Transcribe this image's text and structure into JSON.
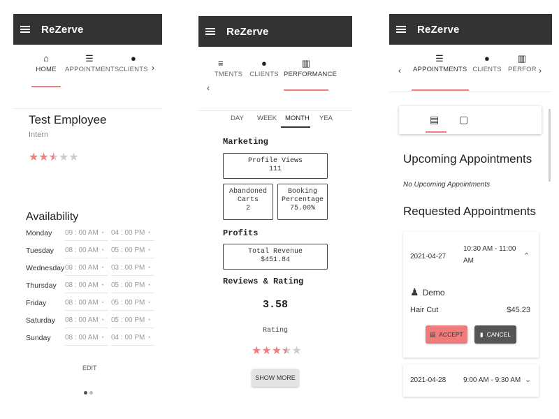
{
  "screens": [
    {
      "app_title": "ReZerve",
      "tabs": [
        {
          "icon": "home-icon",
          "label": "HOME",
          "active": true
        },
        {
          "icon": "list-icon",
          "label": "APPOINTMENTS",
          "active": false
        },
        {
          "icon": "person-icon",
          "label": "CLIENTS",
          "active": false
        }
      ],
      "employee": {
        "name": "Test Employee",
        "role": "Intern",
        "rating_stars": 2.5,
        "star_max": 5
      },
      "availability": {
        "title": "Availability",
        "rows": [
          {
            "day": "Monday",
            "start": "09 : 00  AM",
            "end": "04 : 00  PM"
          },
          {
            "day": "Tuesday",
            "start": "08 : 00  AM",
            "end": "05 : 00  PM"
          },
          {
            "day": "Wednesday",
            "start": "08 : 00  AM",
            "end": "03 : 00  PM"
          },
          {
            "day": "Thursday",
            "start": "08 : 00  AM",
            "end": "05 : 00  PM"
          },
          {
            "day": "Friday",
            "start": "08 : 00  AM",
            "end": "05 : 00  PM"
          },
          {
            "day": "Saturday",
            "start": "08 : 00  AM",
            "end": "05 : 00  PM"
          },
          {
            "day": "Sunday",
            "start": "08 : 00  AM",
            "end": "04 : 00  PM"
          }
        ],
        "edit_label": "EDIT"
      },
      "pager": {
        "pages": 2,
        "current": 1
      }
    },
    {
      "app_title": "ReZerve",
      "tabs": [
        {
          "icon": "list-icon",
          "label": "TMENTS",
          "active": false
        },
        {
          "icon": "person-icon",
          "label": "CLIENTS",
          "active": false
        },
        {
          "icon": "chart-icon",
          "label": "PERFORMANCE",
          "active": true
        }
      ],
      "periods": [
        "DAY",
        "WEEK",
        "MONTH",
        "YEA"
      ],
      "active_period": "MONTH",
      "marketing": {
        "title": "Marketing",
        "profile_views_label": "Profile Views",
        "profile_views": "111",
        "abandoned_label_1": "Abandoned",
        "abandoned_label_2": "Carts",
        "abandoned": "2",
        "booking_label_1": "Booking",
        "booking_label_2": "Percentage",
        "booking": "75.00%"
      },
      "profits": {
        "title": "Profits",
        "revenue_label": "Total Revenue",
        "revenue": "$451.84"
      },
      "reviews": {
        "title": "Reviews & Rating",
        "average": "3.58",
        "rating_label": "Rating",
        "rating_stars": 3.5,
        "star_max": 5
      },
      "show_more_label": "SHOW MORE"
    },
    {
      "app_title": "ReZerve",
      "tabs": [
        {
          "icon": "list-icon",
          "label": "APPOINTMENTS",
          "active": true
        },
        {
          "icon": "person-icon",
          "label": "CLIENTS",
          "active": false
        },
        {
          "icon": "chart-icon",
          "label": "PERFOR",
          "active": false
        }
      ],
      "upcoming_title": "Upcoming Appointments",
      "no_upcoming": "No Upcoming Appointments",
      "requested_title": "Requested Appointments",
      "requests": [
        {
          "date": "2021-04-27",
          "time_1": "10:30 AM - 11:00",
          "time_2": "AM",
          "expanded": true,
          "client": "Demo",
          "service": "Hair Cut",
          "price": "$45.23",
          "accept_label": "ACCEPT",
          "cancel_label": "CANCEL"
        },
        {
          "date": "2021-04-28",
          "time": "9:00 AM - 9:30 AM",
          "expanded": false
        }
      ]
    }
  ],
  "colors": {
    "appbar": "#333333",
    "accent": "#f08080",
    "accept": "#f07b7b",
    "cancel": "#555555"
  }
}
